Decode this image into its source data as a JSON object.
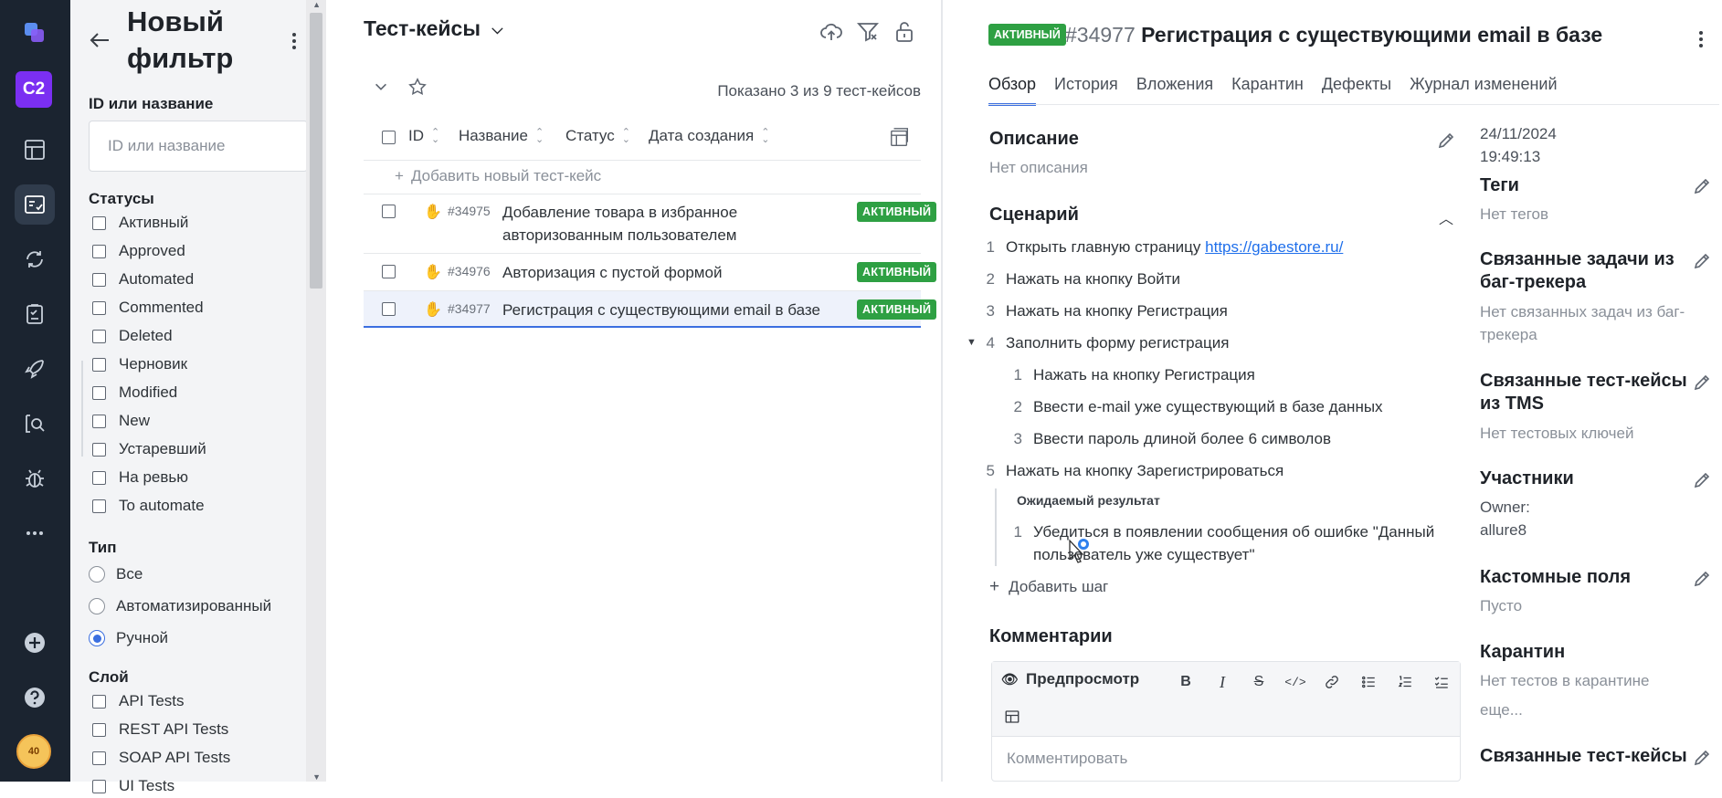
{
  "rail": {
    "project": "C2",
    "avatar": "40",
    "icons": [
      "allure-logo-icon",
      "dashboard-icon",
      "test-cases-icon",
      "launches-icon",
      "test-plans-icon",
      "deploy-icon",
      "search-analytics-icon",
      "defects-icon",
      "more-icon",
      "add-icon",
      "help-icon"
    ]
  },
  "filter": {
    "title_line1": "Новый",
    "title_line2": "фильтр",
    "id_label": "ID или название",
    "id_placeholder": "ID или название",
    "statuses_label": "Статусы",
    "statuses": [
      "Активный",
      "Approved",
      "Automated",
      "Commented",
      "Deleted",
      "Черновик",
      "Modified",
      "New",
      "Устаревший",
      "На ревью",
      "To automate"
    ],
    "type_label": "Тип",
    "types": [
      {
        "label": "Все",
        "selected": false
      },
      {
        "label": "Автоматизированный",
        "selected": false
      },
      {
        "label": "Ручной",
        "selected": true
      }
    ],
    "layer_label": "Слой",
    "layers": [
      "API Tests",
      "REST API Tests",
      "SOAP API Tests",
      "UI Tests"
    ]
  },
  "list": {
    "title": "Тест-кейсы",
    "count": "Показано 3 из 9 тест-кейсов",
    "columns": {
      "id": "ID",
      "name": "Название",
      "status": "Статус",
      "created": "Дата создания"
    },
    "add_label": "Добавить новый тест-кейс",
    "rows": [
      {
        "id": "#34975",
        "name": "Добавление товара в избранное авторизованным пользователем",
        "status": "АКТИВНЫЙ"
      },
      {
        "id": "#34976",
        "name": "Авторизация с пустой формой",
        "status": "АКТИВНЫЙ"
      },
      {
        "id": "#34977",
        "name": "Регистрация с существующими email в базе",
        "status": "АКТИВНЫЙ"
      }
    ]
  },
  "detail": {
    "status": "АКТИВНЫЙ",
    "id": "#34977",
    "title": "Регистрация с существующими email в базе",
    "tabs": [
      "Обзор",
      "История",
      "Вложения",
      "Карантин",
      "Дефекты",
      "Журнал изменений"
    ],
    "description_label": "Описание",
    "description_value": "Нет описания",
    "scenario_label": "Сценарий",
    "steps": {
      "s1_num": "1",
      "s1_text": "Открыть главную страницу",
      "s1_link": "https://gabestore.ru/",
      "s2_num": "2",
      "s2_text": "Нажать на кнопку Войти",
      "s3_num": "3",
      "s3_text": "Нажать на кнопку Регистрация",
      "s4_num": "4",
      "s4_text": "Заполнить форму регистрация",
      "s41_num": "1",
      "s41_text": "Нажать на кнопку Регистрация",
      "s42_num": "2",
      "s42_text": "Ввести e-mail уже существующий в базе данных",
      "s43_num": "3",
      "s43_text": "Ввести пароль длиной более 6 символов",
      "s5_num": "5",
      "s5_text": "Нажать на кнопку Зарегистрироваться",
      "expected_label": "Ожидаемый результат",
      "e1_num": "1",
      "e1_text": "Убедиться в появлении сообщения об ошибке \"Данный пользователь уже существует\""
    },
    "add_step": "Добавить шаг",
    "comments_label": "Комментарии",
    "preview_label": "Предпросмотр",
    "comment_placeholder": "Комментировать"
  },
  "side": {
    "date": "24/11/2024",
    "time": "19:49:13",
    "tags_label": "Теги",
    "tags_value": "Нет тегов",
    "issues_label": "Связанные задачи из баг-трекера",
    "issues_value": "Нет связанных задач из баг-трекера",
    "tms_label": "Связанные тест-кейсы из TMS",
    "tms_value": "Нет тестовых ключей",
    "members_label": "Участники",
    "owner_label": "Owner:",
    "owner_value": "allure8",
    "custom_label": "Кастомные поля",
    "custom_value": "Пусто",
    "quarantine_label": "Карантин",
    "quarantine_value": "Нет тестов в карантине",
    "more": "еще...",
    "linked_label": "Связанные тест-кейсы"
  },
  "colors": {
    "accent": "#3b6fe0",
    "status_active": "#2ea043",
    "rail_bg": "#1b2430",
    "project": "#7b2ff2"
  }
}
